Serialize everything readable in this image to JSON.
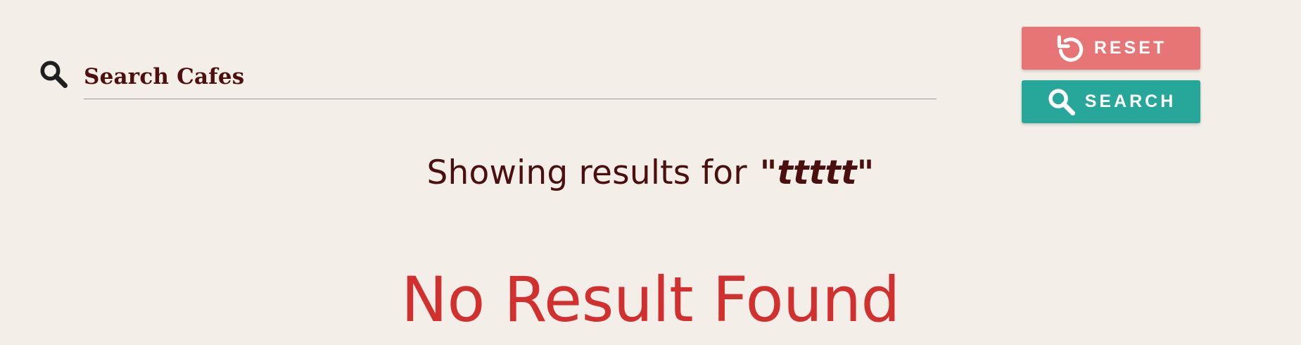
{
  "search": {
    "placeholder": "Search Cafes",
    "value": ""
  },
  "buttons": {
    "reset_label": "RESET",
    "search_label": "SEARCH"
  },
  "results": {
    "prefix": "Showing results for",
    "query": "\"ttttt\"",
    "empty_message": "No Result Found"
  },
  "icons": {
    "search": "search-icon",
    "reset": "reset-icon"
  },
  "colors": {
    "background": "#f3efe8",
    "reset_button": "#e77575",
    "search_button": "#27a79a",
    "results_text": "#4b0f0f",
    "empty_message": "#d22f2f"
  }
}
